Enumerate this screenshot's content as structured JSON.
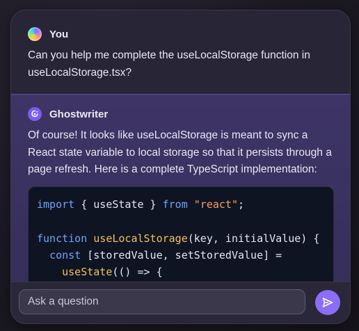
{
  "user_message": {
    "author": "You",
    "text": "Can you help me complete the useLocalStorage function in useLocalStorage.tsx?"
  },
  "assistant_message": {
    "author": "Ghostwriter",
    "text": "Of course! It looks like useLocalStorage is meant to sync a React state variable to local storage so that it persists through a page refresh. Here is a complete TypeScript implementation:",
    "code": {
      "line1": {
        "kw_import": "import",
        "mid": " { useState } ",
        "kw_from": "from",
        "sp": " ",
        "str": "\"react\"",
        "end": ";"
      },
      "line3": {
        "kw_function": "function",
        "sp": " ",
        "fn": "useLocalStorage",
        "rest": "(key, initialValue) {"
      },
      "line4": {
        "indent": "  ",
        "kw_const": "const",
        "rest": " [storedValue, setStoredValue] ="
      },
      "line5": {
        "indent": "    ",
        "fn": "useState",
        "rest": "(() => {"
      }
    }
  },
  "input": {
    "placeholder": "Ask a question"
  },
  "colors": {
    "accent": "#8b6df7",
    "keyword": "#6fa3ff",
    "function": "#f0c15c",
    "string": "#f5a06a"
  }
}
